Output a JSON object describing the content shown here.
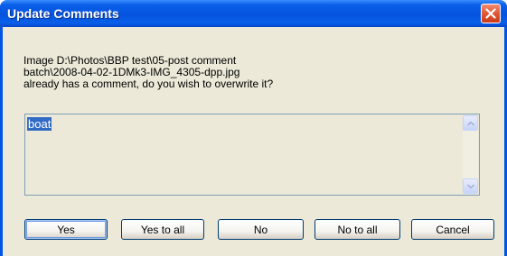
{
  "dialog": {
    "title": "Update Comments",
    "message": "Image D:\\Photos\\BBP test\\05-post comment\nbatch\\2008-04-02-1DMk3-IMG_4305-dpp.jpg\nalready has a comment, do you wish to overwrite it?",
    "comment_value": "boat"
  },
  "buttons": {
    "yes": "Yes",
    "yes_to_all": "Yes to all",
    "no": "No",
    "no_to_all": "No to all",
    "cancel": "Cancel"
  },
  "icons": {
    "close": "close-icon",
    "scroll_up": "scroll-up-arrow-icon",
    "scroll_down": "scroll-down-arrow-icon"
  },
  "colors": {
    "titlebar": "#0553df",
    "client": "#ece9d8",
    "selection": "#316ac5",
    "close_button": "#e05230"
  }
}
